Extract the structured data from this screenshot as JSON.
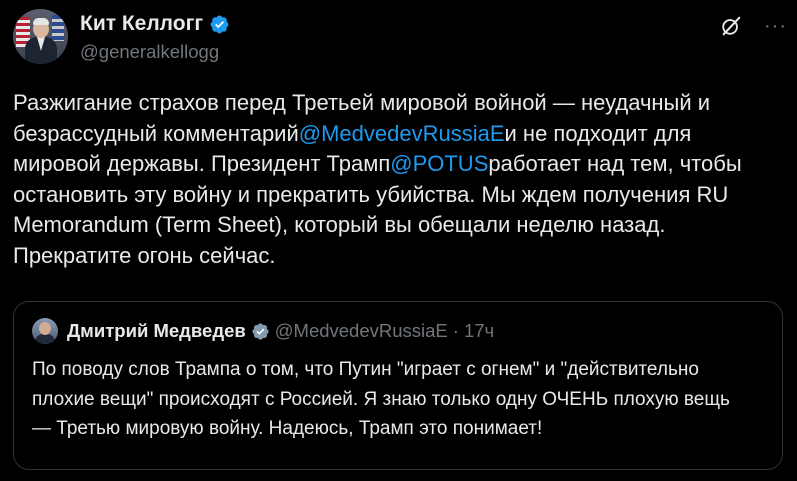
{
  "author": {
    "display_name": "Кит Келлогг",
    "handle": "@generalkellogg"
  },
  "icons": {
    "verified": "verified-badge-icon",
    "grok": "grok-icon",
    "more": "more-options-icon"
  },
  "colors": {
    "background": "#000000",
    "text": "#e7e9ea",
    "secondary": "#71767b",
    "link": "#1d9bf0",
    "border": "#2f3336"
  },
  "tweet": {
    "line1": "Разжигание страхов перед Третьей мировой войной — неудачный и",
    "line2_pre": "безрассудный комментарий",
    "mention1": "@MedvedevRussiaE",
    "line2_post": "и не подходит для",
    "line3_pre": "мировой державы. Президент Трамп",
    "mention2": "@POTUS",
    "line3_post": "работает над тем, чтобы",
    "line4": "остановить эту войну и прекратить убийства. Мы ждем получения RU",
    "line5": "Memorandum (Term Sheet), который вы обещали неделю назад.",
    "line6": "Прекратите огонь сейчас."
  },
  "quote": {
    "display_name": "Дмитрий Медведев",
    "handle": "@MedvedevRussiaE",
    "separator": "·",
    "time": "17ч",
    "line1": "По поводу слов Трампа о том, что Путин \"играет с огнем\" и \"действительно",
    "line2": "плохие вещи\" происходят с Россией. Я знаю только одну ОЧЕНЬ плохую вещь",
    "line3": "— Третью мировую войну. Надеюсь, Трамп это понимает!"
  }
}
